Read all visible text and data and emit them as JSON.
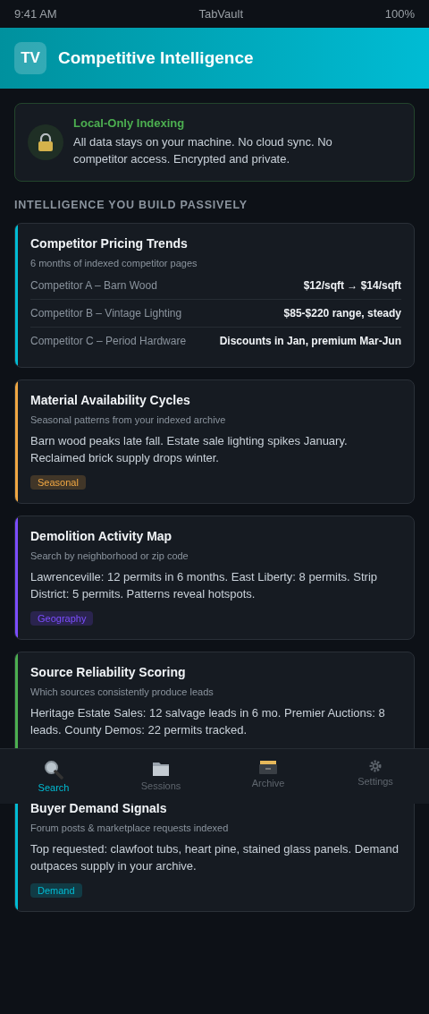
{
  "status_bar": {
    "time": "9:41 AM",
    "app": "TabVault",
    "battery": "100%"
  },
  "header": {
    "logo": "TV",
    "title": "Competitive Intelligence"
  },
  "notice": {
    "title": "Local-Only Indexing",
    "text": "All data stays on your machine. No cloud sync. No competitor access. Encrypted and private."
  },
  "section_title": "INTELLIGENCE YOU BUILD PASSIVELY",
  "cards": [
    {
      "kind": "table",
      "color": "#00bcd4",
      "title": "Competitor Pricing Trends",
      "subtitle": "6 months of indexed competitor pages",
      "rows": [
        {
          "label": "Competitor A – Barn Wood",
          "value": "$12/sqft → $14/sqft"
        },
        {
          "label": "Competitor B – Vintage Lighting",
          "value": "$85-$220 range, steady"
        },
        {
          "label": "Competitor C – Period Hardware",
          "value": "Discounts in Jan, premium Mar-Jun"
        }
      ]
    },
    {
      "kind": "text",
      "color": "#f0a742",
      "title": "Material Availability Cycles",
      "subtitle": "Seasonal patterns from your indexed archive",
      "body": "Barn wood peaks late fall. Estate sale lighting spikes January. Reclaimed brick supply drops winter.",
      "tag": "Seasonal"
    },
    {
      "kind": "text",
      "color": "#7c4dff",
      "title": "Demolition Activity Map",
      "subtitle": "Search by neighborhood or zip code",
      "body": "Lawrenceville: 12 permits in 6 months. East Liberty: 8 permits. Strip District: 5 permits. Patterns reveal hotspots.",
      "tag": "Geography"
    },
    {
      "kind": "text",
      "color": "#4caf50",
      "title": "Source Reliability Scoring",
      "subtitle": "Which sources consistently produce leads",
      "body": "Heritage Estate Sales: 12 salvage leads in 6 mo. Premier Auctions: 8 leads. County Demos: 22 permits tracked."
    },
    {
      "kind": "text",
      "color": "#00bcd4",
      "title": "Buyer Demand Signals",
      "subtitle": "Forum posts & marketplace requests indexed",
      "body": "Top requested: clawfoot tubs, heart pine, stained glass panels. Demand outpaces supply in your archive.",
      "tag": "Demand"
    }
  ],
  "nav": [
    {
      "kind": "search",
      "label": "Search",
      "selected": true
    },
    {
      "kind": "folder",
      "label": "Sessions",
      "selected": false
    },
    {
      "kind": "archive",
      "label": "Archive",
      "selected": false
    },
    {
      "kind": "settings",
      "label": "Settings",
      "selected": false
    }
  ]
}
